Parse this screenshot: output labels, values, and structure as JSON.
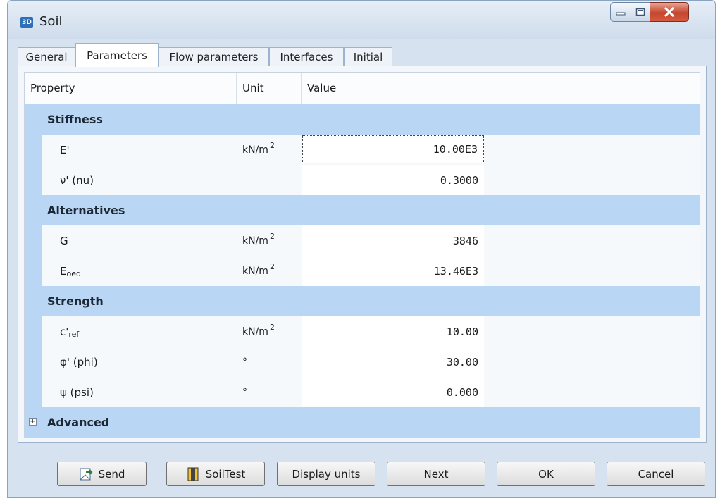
{
  "window": {
    "title": "Soil",
    "app_badge": "3D"
  },
  "tabs": [
    {
      "label": "General"
    },
    {
      "label": "Parameters"
    },
    {
      "label": "Flow parameters"
    },
    {
      "label": "Interfaces"
    },
    {
      "label": "Initial"
    }
  ],
  "grid": {
    "headers": {
      "property": "Property",
      "unit": "Unit",
      "value": "Value"
    },
    "sections": {
      "stiffness": "Stiffness",
      "alternatives": "Alternatives",
      "strength": "Strength",
      "advanced": "Advanced"
    },
    "rows": {
      "e": {
        "prop": "E'",
        "unit": "kN/m",
        "unit_exp": "2",
        "value": "10.00E3"
      },
      "nu": {
        "prop": "ν' (nu)",
        "unit": "",
        "value": "0.3000"
      },
      "g": {
        "prop": "G",
        "unit": "kN/m",
        "unit_exp": "2",
        "value": "3846"
      },
      "eoed": {
        "prop": "E",
        "prop_sub": "oed",
        "unit": "kN/m",
        "unit_exp": "2",
        "value": "13.46E3"
      },
      "cref": {
        "prop": "c'",
        "prop_sub": "ref",
        "unit": "kN/m",
        "unit_exp": "2",
        "value": "10.00"
      },
      "phi": {
        "prop": "φ' (phi)",
        "unit": "°",
        "value": "30.00"
      },
      "psi": {
        "prop": "ψ (psi)",
        "unit": "°",
        "value": "0.000"
      }
    },
    "advanced_expander": "+"
  },
  "buttons": {
    "send": "Send",
    "soiltest": "SoilTest",
    "display_units": "Display units",
    "next": "Next",
    "ok": "OK",
    "cancel": "Cancel"
  },
  "colors": {
    "section_bg": "#b9d7f5",
    "close_button": "#c5462e"
  }
}
